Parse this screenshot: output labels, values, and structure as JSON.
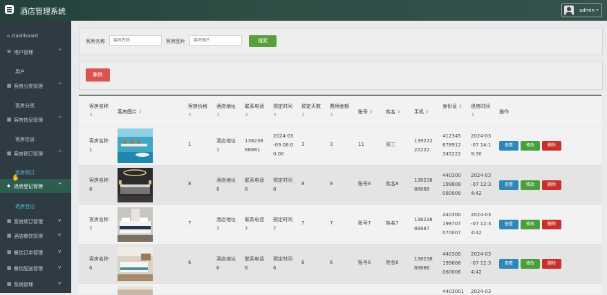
{
  "header": {
    "app_title": "酒店管理系统",
    "user_name": "admin",
    "user_caret": "▾"
  },
  "sidebar": {
    "items": [
      {
        "icon": "⌂",
        "label": "Dashboard",
        "chevron": ""
      },
      {
        "icon": "☰",
        "label": "用户管理",
        "chevron": "^"
      },
      {
        "sub": "用户"
      },
      {
        "icon": "▦",
        "label": "客房分类管理",
        "chevron": "^"
      },
      {
        "sub": "客房分类"
      },
      {
        "icon": "▦",
        "label": "客房信息管理",
        "chevron": "^"
      },
      {
        "sub": "客房信息"
      },
      {
        "icon": "▦",
        "label": "客房预订管理",
        "chevron": "^"
      },
      {
        "sub": "客房预订"
      },
      {
        "icon": "⬥",
        "label": "退房登记管理",
        "chevron": "^"
      },
      {
        "sub": "退房登记"
      },
      {
        "icon": "▦",
        "label": "客房续订管理",
        "chevron": "v"
      },
      {
        "icon": "▦",
        "label": "酒店餐饮管理",
        "chevron": "v"
      },
      {
        "icon": "▦",
        "label": "餐饮订单管理",
        "chevron": "v"
      },
      {
        "icon": "▦",
        "label": "餐饮配送管理",
        "chevron": "v"
      },
      {
        "icon": "▦",
        "label": "系统管理",
        "chevron": "v"
      }
    ]
  },
  "search": {
    "room_name_label": "客房名称",
    "room_name_placeholder": "客房名称",
    "room_image_label": "客房图片",
    "room_image_placeholder": "客房图片",
    "search_button": "搜索"
  },
  "toolbar": {
    "delete_button": "删除"
  },
  "table": {
    "headers": [
      "客房名称",
      "客房图片",
      "客房价格",
      "酒店地址",
      "联系电话",
      "预定时间",
      "预定天数",
      "费用金额",
      "账号",
      "姓名",
      "手机",
      "身份证",
      "退房时间",
      "操作"
    ],
    "sort_glyph": "⇕",
    "actions": {
      "view": "查看",
      "edit": "修改",
      "delete": "删除"
    },
    "rows": [
      {
        "name": "客房名称1",
        "price": "1",
        "address": "酒店地址1",
        "phone": "13823888881",
        "book_time": "2024-03-09 08:00:00",
        "days": "3",
        "amount": "3",
        "account": "11",
        "person": "张三",
        "mobile": "13922222222",
        "id_card": "412345678912345222",
        "checkout": "2024-03-07 14:19:30",
        "image": "sea-villas"
      },
      {
        "name": "客房名称8",
        "price": "8",
        "address": "酒店地址8",
        "phone": "联系电话8",
        "book_time": "预定时间8",
        "days": "8",
        "amount": "8",
        "account": "账号8",
        "person": "姓名8",
        "mobile": "13823888888",
        "id_card": "440300199808080008",
        "checkout": "2024-03-07 12:34:42",
        "image": "dark-suite"
      },
      {
        "name": "客房名称7",
        "price": "7",
        "address": "酒店地址7",
        "phone": "联系电话7",
        "book_time": "预定时间7",
        "days": "7",
        "amount": "7",
        "account": "账号7",
        "person": "姓名7",
        "mobile": "13823888887",
        "id_card": "440300199707070007",
        "checkout": "2024-03-07 12:34:42",
        "image": "twin-room"
      },
      {
        "name": "客房名称6",
        "price": "6",
        "address": "酒店地址6",
        "phone": "联系电话6",
        "book_time": "预定时间6",
        "days": "6",
        "amount": "6",
        "account": "账号6",
        "person": "姓名6",
        "mobile": "13823888886",
        "id_card": "440300199606060006",
        "checkout": "2024-03-07 12:34:42",
        "image": "bright-room"
      }
    ]
  },
  "partial_row": {
    "id_card": "4403001",
    "checkout": "2024-03"
  },
  "colors": {
    "topbar": "#2d4d45",
    "sidebar": "#2f3b43",
    "active": "#2c5d4e",
    "search_btn": "#5a9f3c",
    "delete_btn": "#d9534f",
    "view_btn": "#2f87b9",
    "edit_btn": "#4a9f3c",
    "row_delete_btn": "#c9302c"
  }
}
